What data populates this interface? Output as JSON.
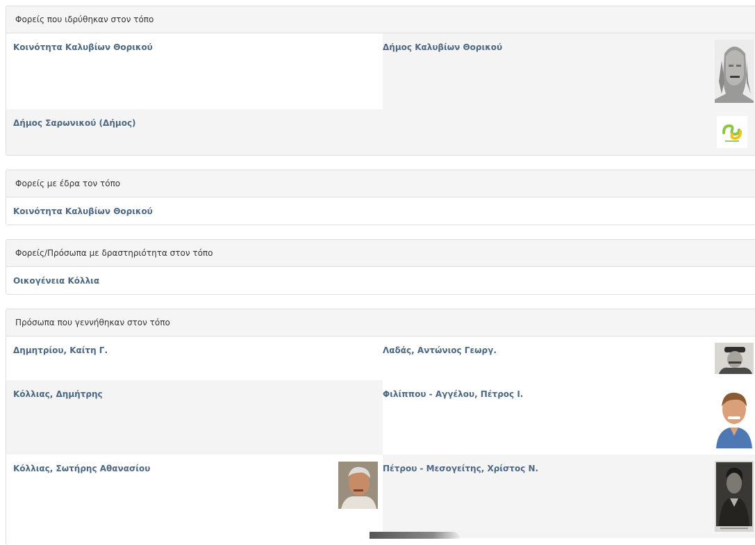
{
  "sections": [
    {
      "heading": "Φορείς που ιδρύθηκαν στον τόπο",
      "items": [
        {
          "label": "Κοινότητα Καλυβίων Θορικού"
        },
        {
          "label": "Δήμος Καλυβίων Θορικού",
          "icon": "kouros-statue-image"
        },
        {
          "label": "Δήμος Σαρωνικού (Δήμος)",
          "icon": "saronikos-logo-image"
        }
      ]
    },
    {
      "heading": "Φορείς με έδρα τον τόπο",
      "items": [
        {
          "label": "Κοινότητα Καλυβίων Θορικού"
        }
      ]
    },
    {
      "heading": "Φορείς/Πρόσωπα με δραστηριότητα στον τόπο",
      "items": [
        {
          "label": "Οικογένεια Κόλλια"
        }
      ]
    },
    {
      "heading": "Πρόσωπα που γεννήθηκαν στον τόπο",
      "items": [
        {
          "label": "Δημητρίου, Καίτη Γ."
        },
        {
          "label": "Λαδάς, Αντώνιος Γεωργ.",
          "icon": "portrait-photo"
        },
        {
          "label": "Κόλλιας, Δημήτρης"
        },
        {
          "label": "Φιλίππου - Αγγέλου, Πέτρος Ι.",
          "icon": "portrait-photo"
        },
        {
          "label": "Κόλλιας, Σωτήρης Αθανασίου",
          "icon": "portrait-photo"
        },
        {
          "label": "Πέτρου - Μεσογείτης, Χρίστος Ν.",
          "icon": "portrait-photo"
        }
      ]
    }
  ]
}
